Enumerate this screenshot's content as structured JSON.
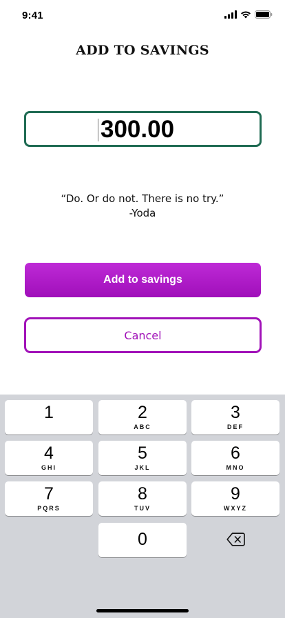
{
  "status_bar": {
    "time": "9:41",
    "icons": [
      "cellular-signal-icon",
      "wifi-icon",
      "battery-icon"
    ]
  },
  "page": {
    "title": "ADD TO SAVINGS"
  },
  "amount_input": {
    "value": "300.00",
    "border_color": "#1f6b53"
  },
  "quote": {
    "text": "“Do. Or do not. There is no try.”",
    "author": "-Yoda"
  },
  "buttons": {
    "add_label": "Add to savings",
    "cancel_label": "Cancel",
    "accent_color": "#a112b8"
  },
  "keypad": {
    "keys": [
      {
        "digit": "1",
        "letters": ""
      },
      {
        "digit": "2",
        "letters": "ABC"
      },
      {
        "digit": "3",
        "letters": "DEF"
      },
      {
        "digit": "4",
        "letters": "GHI"
      },
      {
        "digit": "5",
        "letters": "JKL"
      },
      {
        "digit": "6",
        "letters": "MNO"
      },
      {
        "digit": "7",
        "letters": "PQRS"
      },
      {
        "digit": "8",
        "letters": "TUV"
      },
      {
        "digit": "9",
        "letters": "WXYZ"
      },
      {
        "digit": "0",
        "letters": ""
      }
    ],
    "delete_icon": "backspace-icon"
  }
}
